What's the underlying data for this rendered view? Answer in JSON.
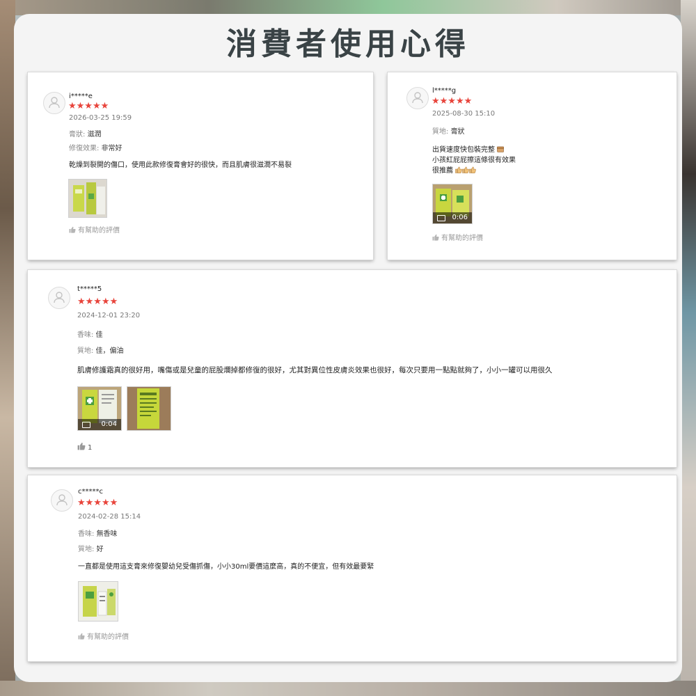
{
  "page": {
    "title": "消費者使用心得"
  },
  "colors": {
    "star": "#e8443b",
    "title": "#3a4346",
    "panel": "#f4f4f4"
  },
  "reviews": [
    {
      "username": "i*****e",
      "stars": "★★★★★",
      "date": "2026-03-25 19:59",
      "attributes": [
        {
          "key": "膏狀:",
          "value": "滋潤"
        },
        {
          "key": "修復效果:",
          "value": "非常好"
        }
      ],
      "comment": "乾燥到裂開的傷口，使用此款修復膏會好的很快，而且肌膚很滋潤不易裂",
      "helpful": "有幫助的評價"
    },
    {
      "username": "l*****g",
      "stars": "★★★★★",
      "date": "2025-08-30 15:10",
      "attributes": [
        {
          "key": "質地:",
          "value": "膏狀"
        }
      ],
      "comment_lines": [
        "出貨速度快包裝完整",
        "小孩紅屁屁擦這條很有效果",
        "很推薦"
      ],
      "video_duration": "0:06",
      "helpful": "有幫助的評價"
    },
    {
      "username": "t*****5",
      "stars": "★★★★★",
      "date": "2024-12-01 23:20",
      "attributes": [
        {
          "key": "香味:",
          "value": "佳"
        },
        {
          "key": "質地:",
          "value": "佳，偏油"
        }
      ],
      "comment": "肌膚修護霜真的很好用，嘴傷或是兒童的屁股爛掉都修復的很好，尤其對異位性皮膚炎效果也很好，每次只要用一點點就夠了，小小一罐可以用很久",
      "video_duration": "0:04",
      "helpful_count": "1"
    },
    {
      "username": "c*****c",
      "stars": "★★★★★",
      "date": "2024-02-28 15:14",
      "attributes": [
        {
          "key": "香味:",
          "value": "無香味"
        },
        {
          "key": "質地:",
          "value": "好"
        }
      ],
      "comment": "一直都是使用這支膏來修復嬰幼兒受傷抓傷，小小30ml要價這麼高，真的不便宜，但有效最要緊",
      "helpful": "有幫助的評價"
    }
  ]
}
